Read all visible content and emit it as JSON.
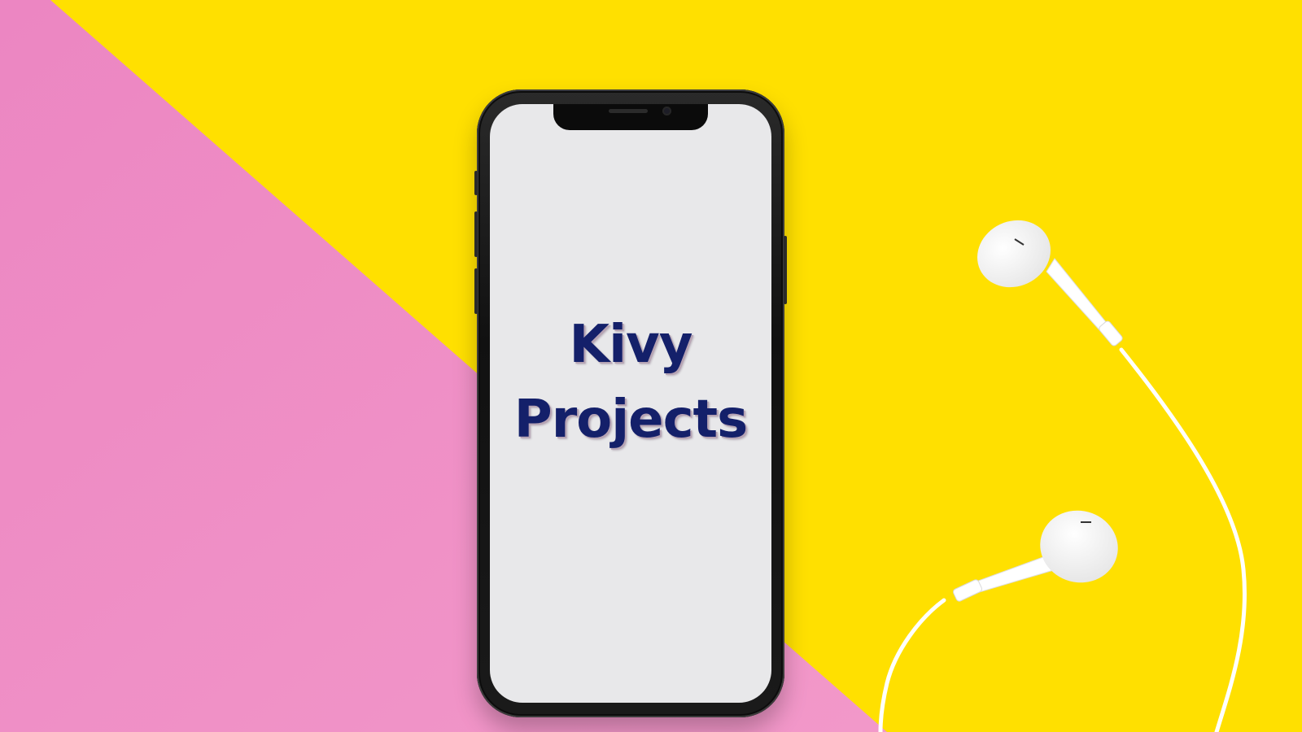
{
  "screen": {
    "title_line1": "Kivy",
    "title_line2": "Projects"
  },
  "colors": {
    "background_yellow": "#ffe000",
    "background_pink": "#f08cc7",
    "screen_white": "#e8e8ea",
    "title_navy": "#14206a",
    "phone_black": "#111111",
    "earphone_white": "#ffffff"
  }
}
